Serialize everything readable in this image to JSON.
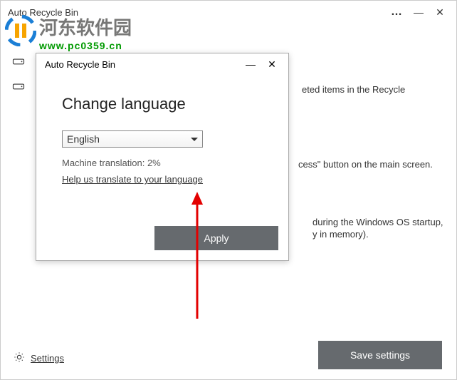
{
  "main": {
    "title": "Auto Recycle Bin",
    "bg_text_1": "eted items in the Recycle",
    "bg_text_2": "cess\" button on the main screen.",
    "bg_text_3": "during the Windows OS startup,",
    "bg_text_4": "y in memory).",
    "settings_label": "Settings",
    "save_button": "Save settings"
  },
  "watermark": {
    "title": "河东软件园",
    "url": "www.pc0359.cn"
  },
  "dialog": {
    "title": "Auto Recycle Bin",
    "heading": "Change language",
    "selected_language": "English",
    "machine_translation": "Machine translation: 2%",
    "help_link": "Help us translate to your language",
    "apply": "Apply"
  }
}
